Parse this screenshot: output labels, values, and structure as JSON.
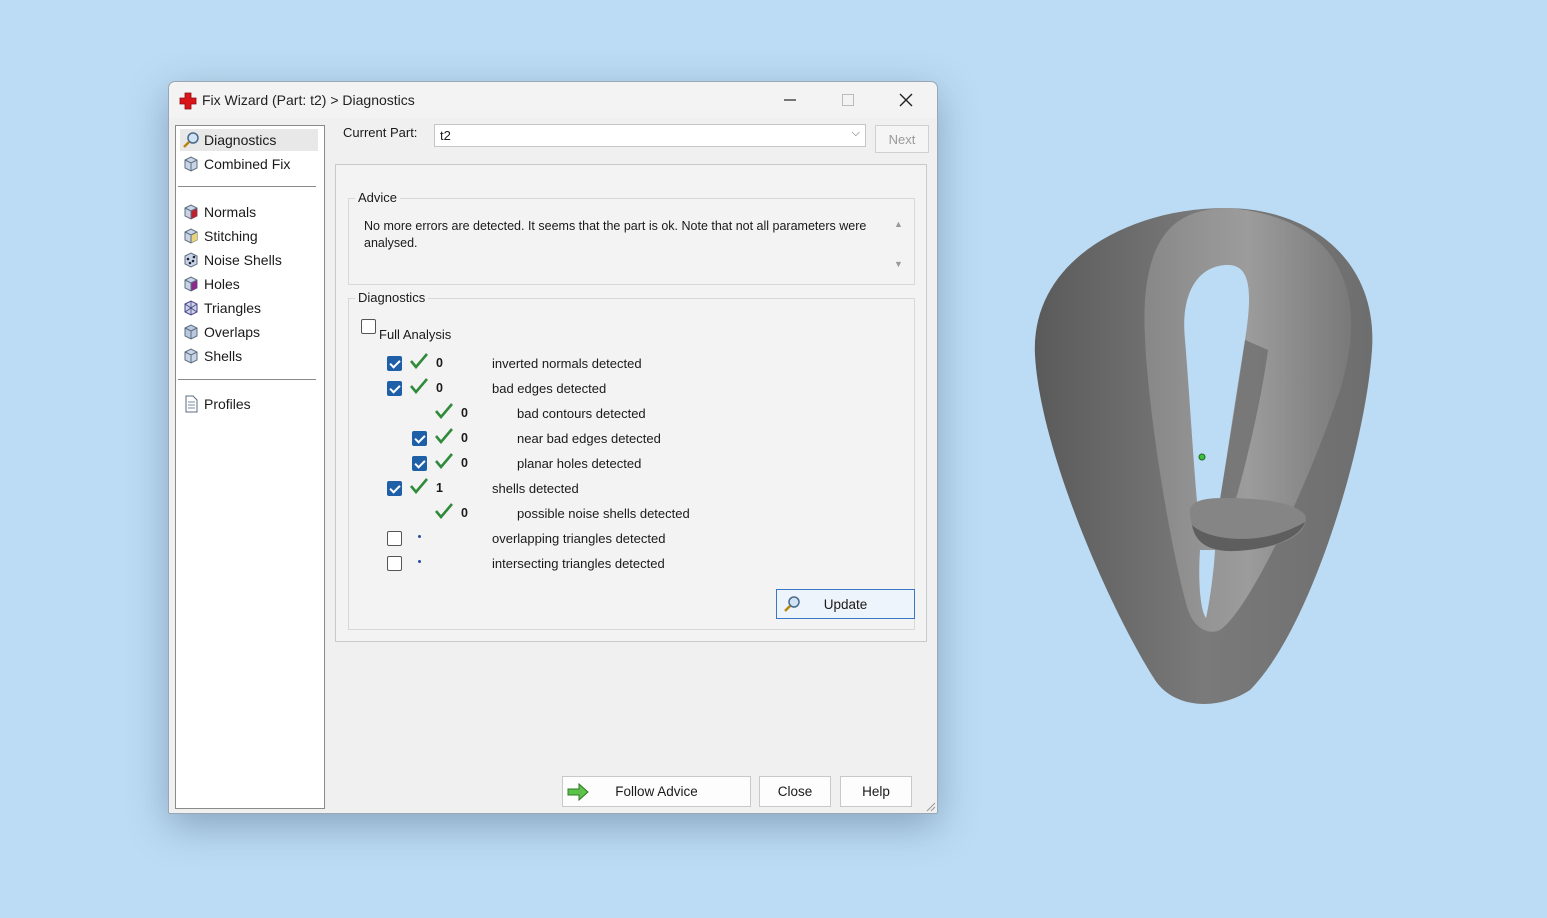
{
  "window": {
    "title": "Fix Wizard (Part: t2) > Diagnostics",
    "controls": {
      "minimize": "—",
      "maximize": "☐",
      "close": "✕"
    }
  },
  "sidebar": {
    "items": [
      {
        "label": "Diagnostics",
        "icon": "magnifier-icon"
      },
      {
        "label": "Combined Fix",
        "icon": "cube-icon"
      },
      {
        "label": "Normals",
        "icon": "cube-red-face-icon"
      },
      {
        "label": "Stitching",
        "icon": "cube-yellow-face-icon"
      },
      {
        "label": "Noise Shells",
        "icon": "noise-cube-icon"
      },
      {
        "label": "Holes",
        "icon": "cube-hole-icon"
      },
      {
        "label": "Triangles",
        "icon": "triangles-cube-icon"
      },
      {
        "label": "Overlaps",
        "icon": "overlap-cube-icon"
      },
      {
        "label": "Shells",
        "icon": "shell-cube-icon"
      },
      {
        "label": "Profiles",
        "icon": "document-icon"
      }
    ]
  },
  "part": {
    "label": "Current Part:",
    "value": "t2",
    "next_label": "Next"
  },
  "advice": {
    "title": "Advice",
    "text": "No more errors are detected. It seems that the part is ok. Note that not all parameters were analysed."
  },
  "diagnostics": {
    "title": "Diagnostics",
    "full_analysis_label": "Full Analysis",
    "rows": [
      {
        "count": "0",
        "label": "inverted normals detected",
        "checked": true,
        "status": "ok",
        "indent": 0
      },
      {
        "count": "0",
        "label": "bad edges detected",
        "checked": true,
        "status": "ok",
        "indent": 0
      },
      {
        "count": "0",
        "label": "bad contours detected",
        "checked": null,
        "status": "ok",
        "indent": 1
      },
      {
        "count": "0",
        "label": "near bad edges detected",
        "checked": true,
        "status": "ok",
        "indent": 1
      },
      {
        "count": "0",
        "label": "planar holes detected",
        "checked": true,
        "status": "ok",
        "indent": 1
      },
      {
        "count": "1",
        "label": "shells detected",
        "checked": true,
        "status": "ok",
        "indent": 0
      },
      {
        "count": "0",
        "label": "possible noise shells detected",
        "checked": null,
        "status": "ok",
        "indent": 1
      },
      {
        "count": "",
        "label": "overlapping triangles detected",
        "checked": false,
        "status": "none",
        "indent": 0
      },
      {
        "count": "",
        "label": "intersecting triangles detected",
        "checked": false,
        "status": "none",
        "indent": 0
      }
    ],
    "update_label": "Update"
  },
  "footer": {
    "follow_advice_label": "Follow Advice",
    "close_label": "Close",
    "help_label": "Help"
  },
  "colors": {
    "desktop": "#bcdcf5",
    "check_green": "#2f8a3a",
    "checkbox_blue": "#1f5fa8",
    "model_gray": "#707070"
  }
}
